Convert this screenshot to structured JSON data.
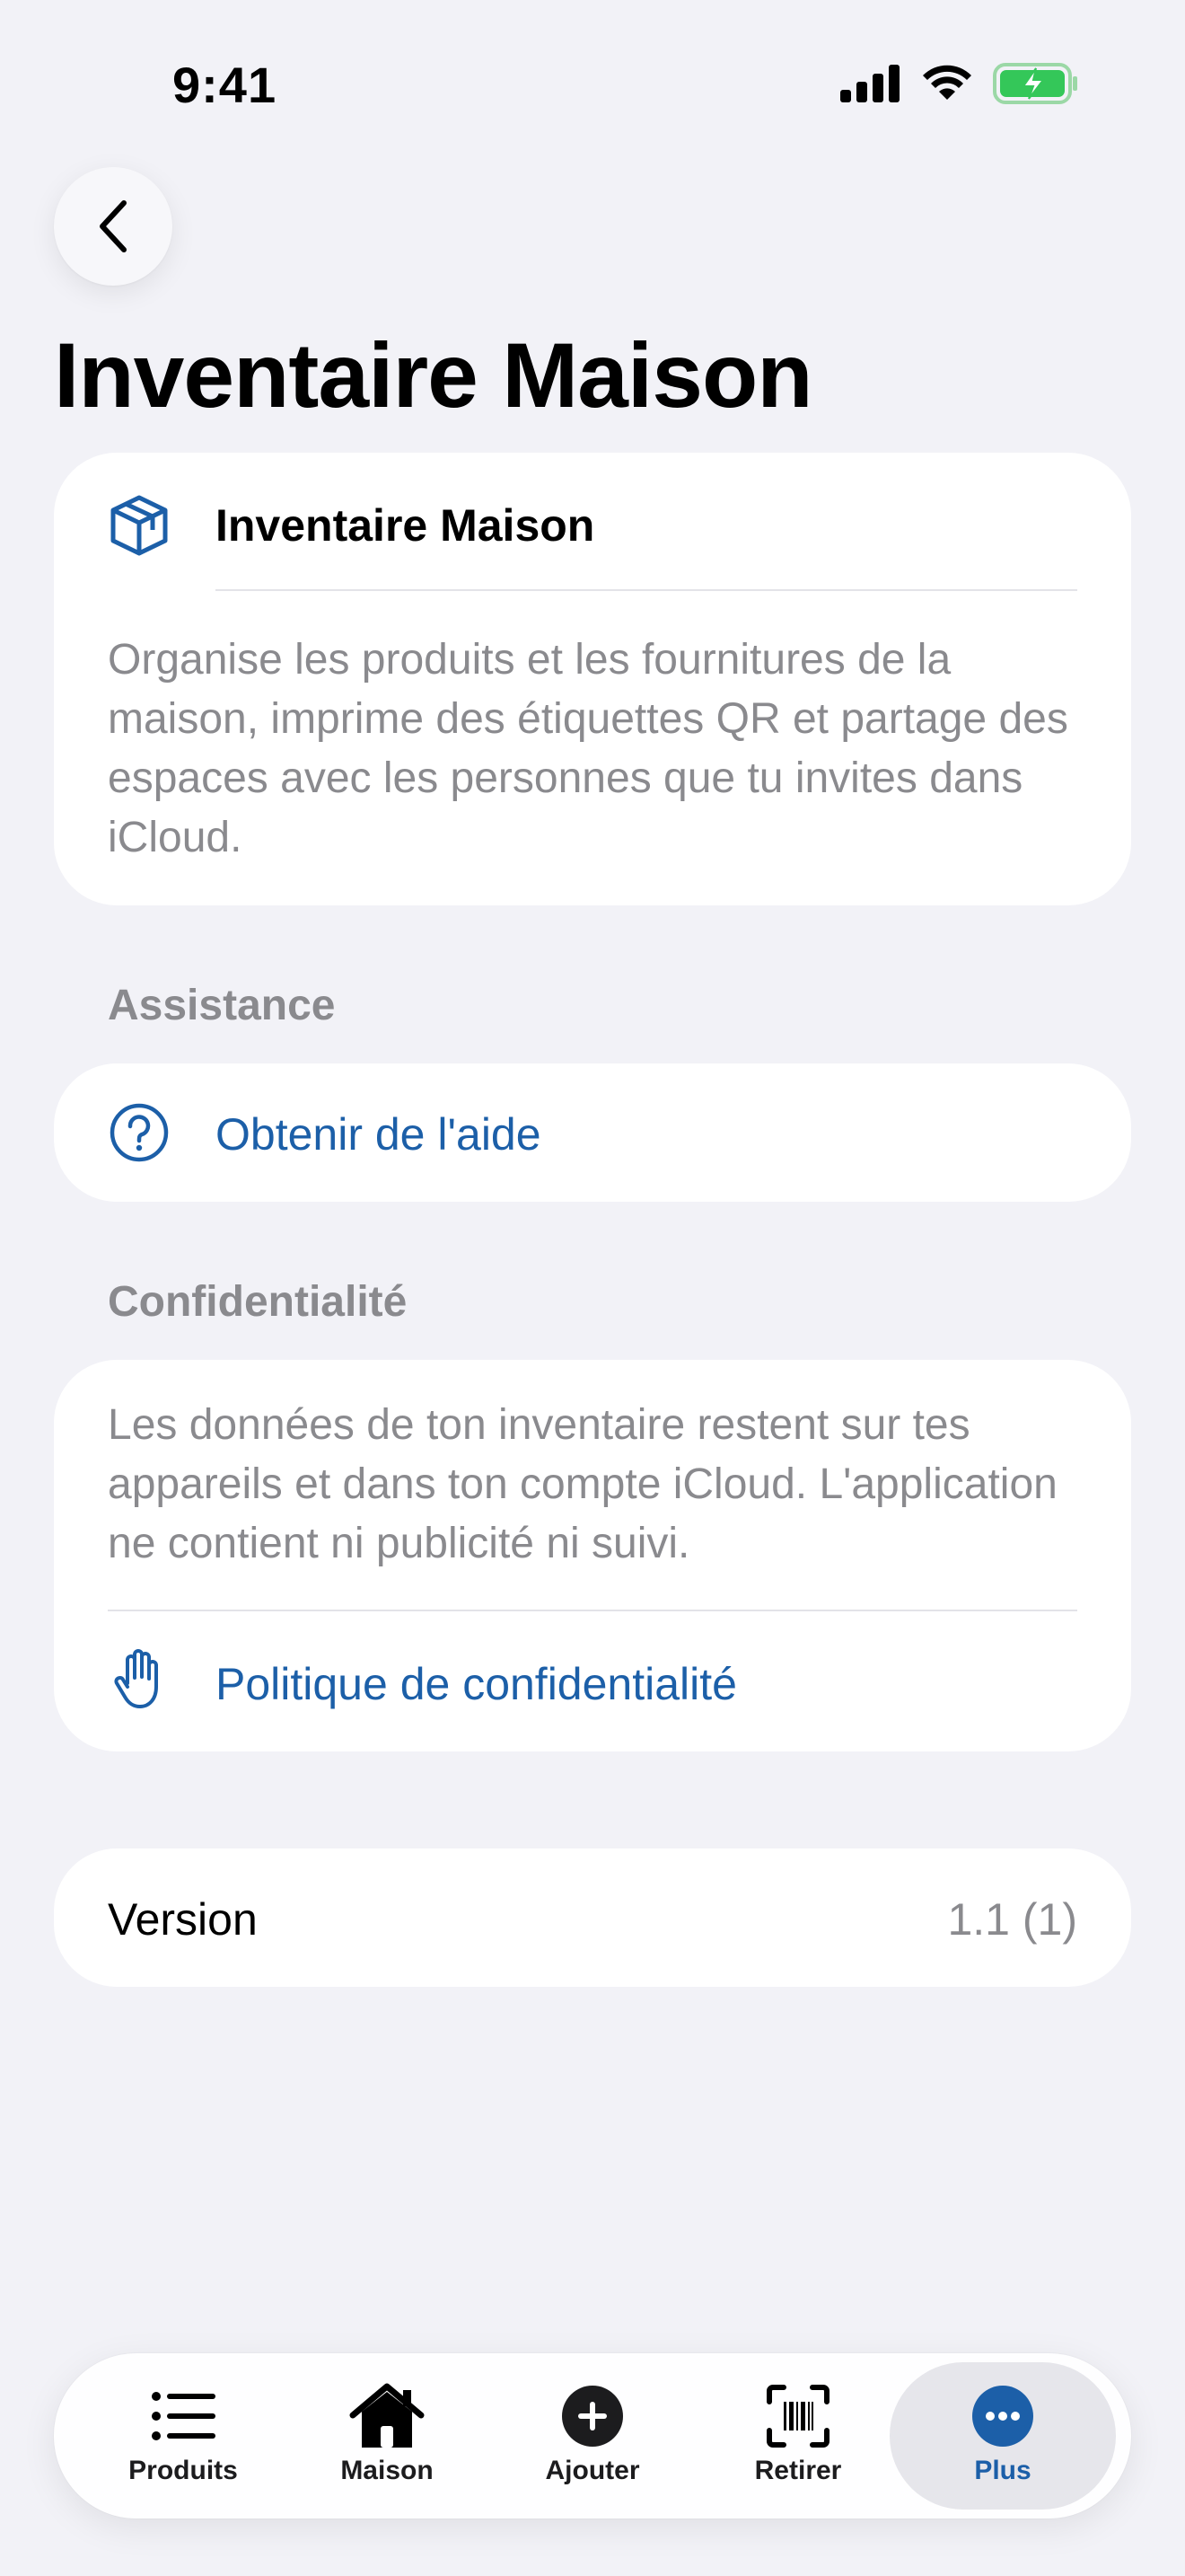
{
  "status_bar": {
    "time": "9:41"
  },
  "header": {
    "title": "Inventaire Maison"
  },
  "app_info": {
    "name": "Inventaire Maison",
    "description": "Organise les produits et les fournitures de la maison, imprime des étiquettes QR et partage des espaces avec les personnes que tu invites dans iCloud.",
    "icon": "package-icon"
  },
  "assistance": {
    "header": "Assistance",
    "help_label": "Obtenir de l'aide",
    "help_icon": "question-circle-icon"
  },
  "privacy": {
    "header": "Confidentialité",
    "text": "Les données de ton inventaire restent sur tes appareils et dans ton compte iCloud. L'application ne contient ni publicité ni suivi.",
    "policy_label": "Politique de confidentialité",
    "policy_icon": "hand-icon"
  },
  "version": {
    "label": "Version",
    "value": "1.1 (1)"
  },
  "tab_bar": {
    "tabs": [
      {
        "label": "Produits",
        "icon": "list-icon"
      },
      {
        "label": "Maison",
        "icon": "house-icon"
      },
      {
        "label": "Ajouter",
        "icon": "plus-circle-icon"
      },
      {
        "label": "Retirer",
        "icon": "barcode-scan-icon"
      },
      {
        "label": "Plus",
        "icon": "ellipsis-circle-icon"
      }
    ],
    "active_index": 4
  },
  "colors": {
    "accent": "#1C5FA8",
    "background": "#F2F2F7",
    "secondary_text": "#8A8A8E",
    "battery_green": "#34C759"
  }
}
